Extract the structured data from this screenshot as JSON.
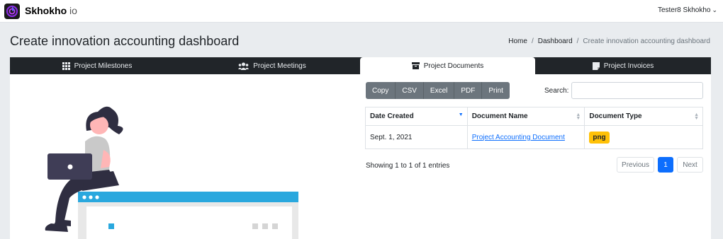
{
  "brand": {
    "name": "Skhokho",
    "suffix": "io"
  },
  "user": {
    "name": "Tester8 Skhokho"
  },
  "page": {
    "title": "Create innovation accounting dashboard"
  },
  "breadcrumb": {
    "home": "Home",
    "dashboard": "Dashboard",
    "current": "Create innovation accounting dashboard"
  },
  "tabs": [
    {
      "label": "Project Milestones",
      "icon": "grid-icon"
    },
    {
      "label": "Project Meetings",
      "icon": "users-icon"
    },
    {
      "label": "Project Documents",
      "icon": "archive-icon"
    },
    {
      "label": "Project Invoices",
      "icon": "invoice-icon"
    }
  ],
  "export_buttons": [
    "Copy",
    "CSV",
    "Excel",
    "PDF",
    "Print"
  ],
  "search": {
    "label": "Search:",
    "value": ""
  },
  "table": {
    "headers": [
      "Date Created",
      "Document Name",
      "Document Type"
    ],
    "rows": [
      {
        "date": "Sept. 1, 2021",
        "name": "Project Accounting Document",
        "type": "png"
      }
    ]
  },
  "info": "Showing 1 to 1 of 1 entries",
  "pagination": {
    "previous": "Previous",
    "current": "1",
    "next": "Next"
  },
  "colors": {
    "primary": "#0d6efd",
    "tab_bar": "#212529",
    "badge": "#ffc107",
    "button": "#6c757d",
    "accent_illustration": "#2aa8de"
  }
}
